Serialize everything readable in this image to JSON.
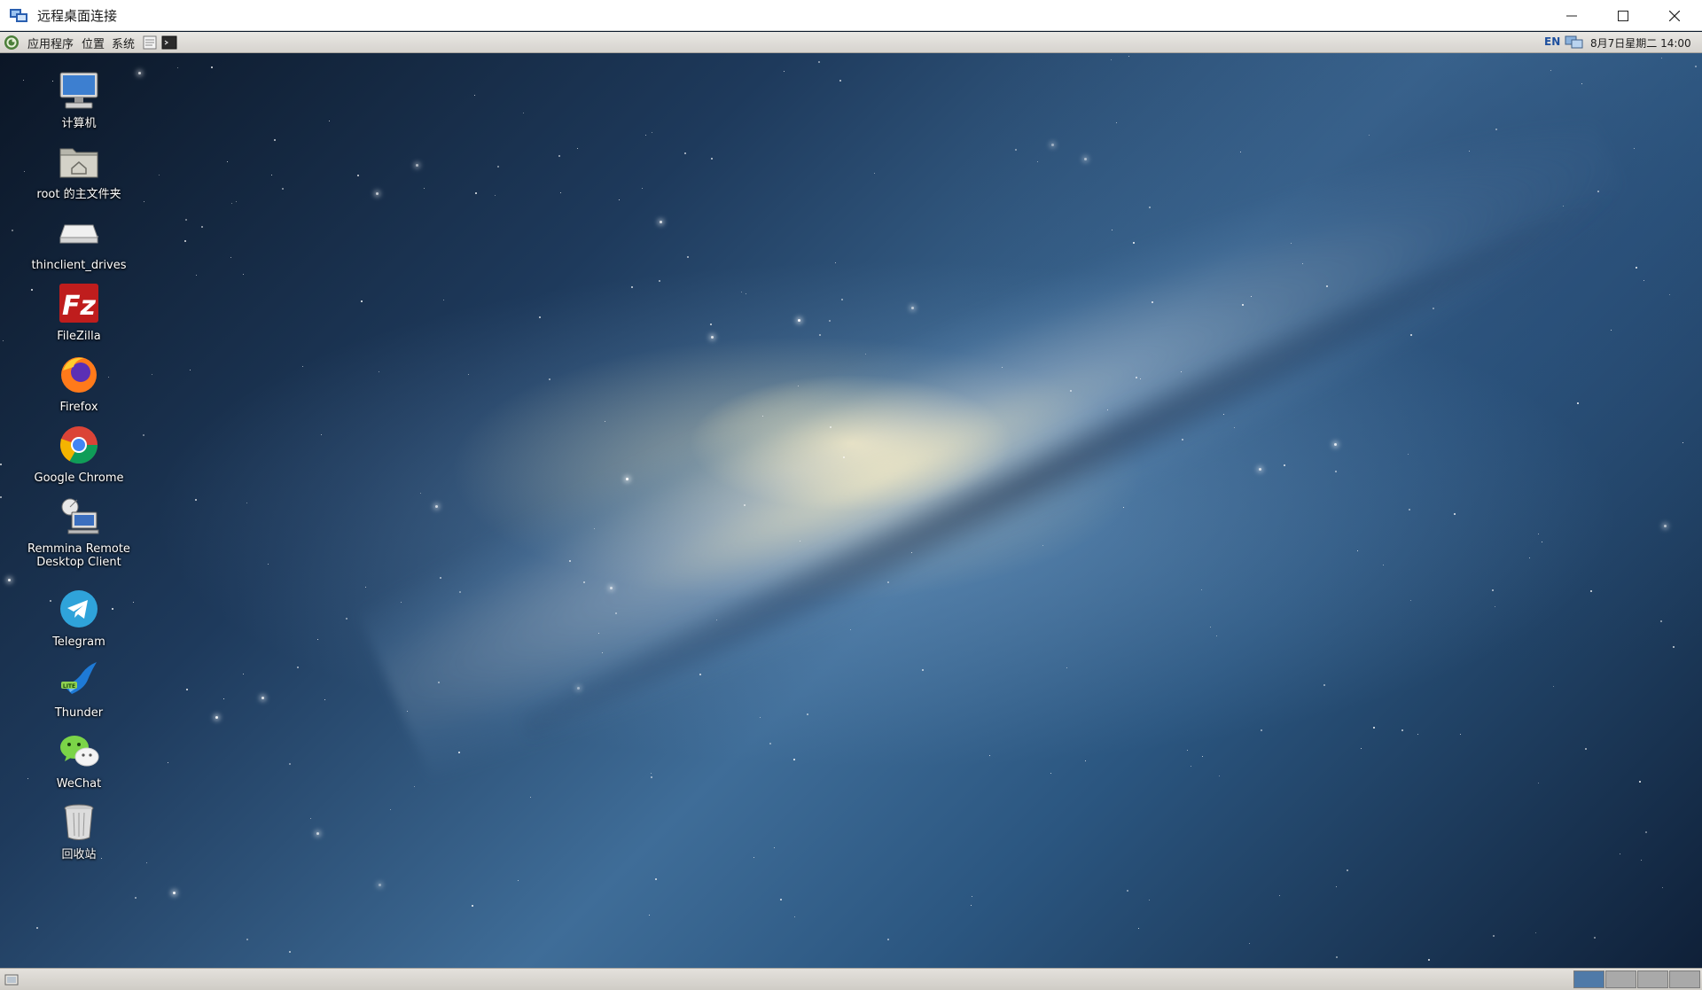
{
  "window": {
    "title": "远程桌面连接",
    "controls": [
      "minimize",
      "maximize",
      "close"
    ]
  },
  "top_panel": {
    "menus": [
      "应用程序",
      "位置",
      "系统"
    ],
    "input_method": "EN",
    "datetime": "8月7日星期二 14:00"
  },
  "desktop": {
    "icons": [
      {
        "label": "计算机",
        "icon": "computer-icon"
      },
      {
        "label": "root 的主文件夹",
        "icon": "home-folder-icon"
      },
      {
        "label": "thinclient_drives",
        "icon": "drive-icon"
      },
      {
        "label": "FileZilla",
        "icon": "filezilla-icon"
      },
      {
        "label": "Firefox",
        "icon": "firefox-icon"
      },
      {
        "label": "Google Chrome",
        "icon": "chrome-icon"
      },
      {
        "label": "Remmina Remote Desktop Client",
        "label_line1": "Remmina Remote",
        "label_line2": "Desktop Client",
        "icon": "remmina-icon"
      },
      {
        "label": "Telegram",
        "icon": "telegram-icon"
      },
      {
        "label": "Thunder",
        "icon": "thunder-icon"
      },
      {
        "label": "WeChat",
        "icon": "wechat-icon"
      },
      {
        "label": "回收站",
        "icon": "trash-icon"
      }
    ]
  },
  "bottom_panel": {
    "workspaces": 4,
    "active_workspace": 1
  },
  "colors": {
    "workspace_active": "#4f7aa8",
    "workspace_inactive": "#a9a9a9"
  }
}
